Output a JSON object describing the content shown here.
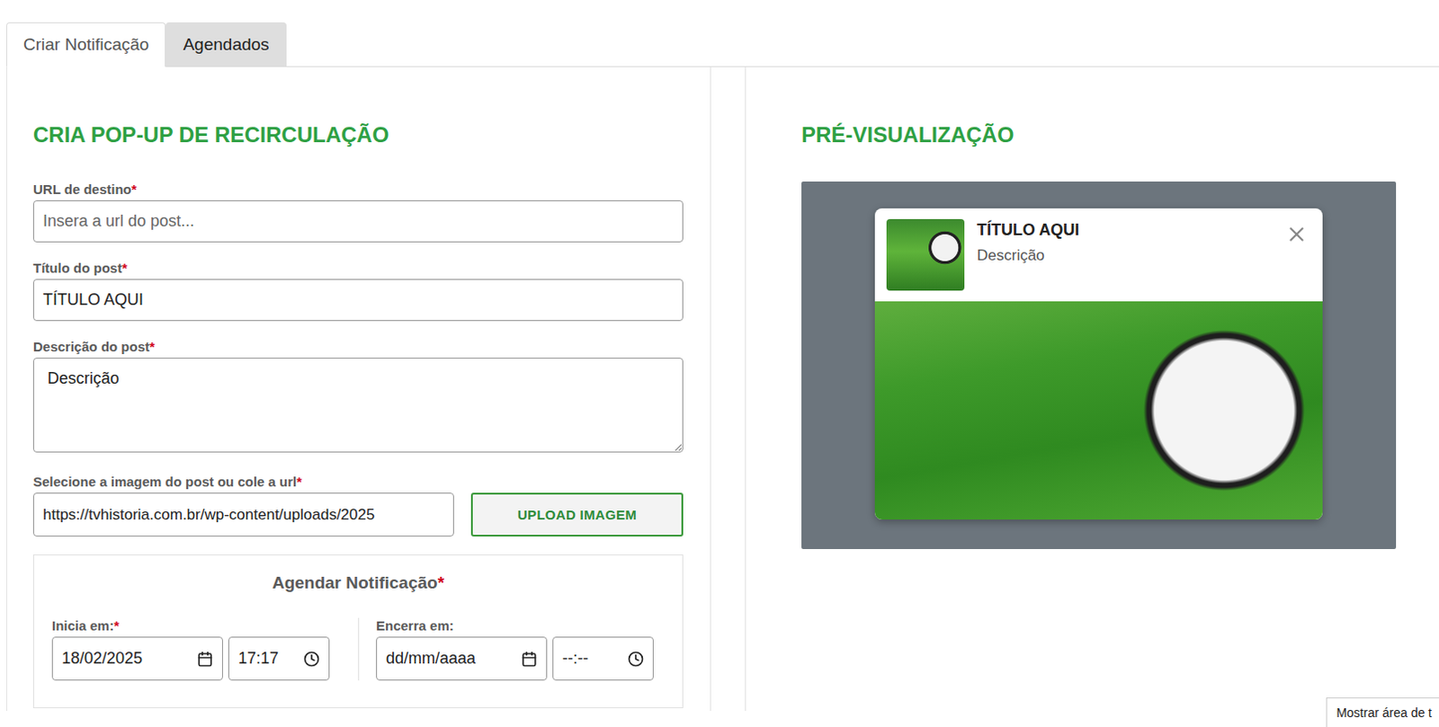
{
  "tabs": [
    {
      "label": "Criar Notificação",
      "selected": true
    },
    {
      "label": "Agendados",
      "selected": false
    }
  ],
  "form": {
    "heading": "CRIA POP-UP DE RECIRCULAÇÃO",
    "required_mark": "*",
    "fields": [
      {
        "label": "URL de destino",
        "required": true,
        "kind": "input",
        "value": "",
        "placeholder": "Insera a url do post..."
      },
      {
        "label": "Título do post",
        "required": true,
        "kind": "input",
        "value": "TÍTULO AQUI",
        "placeholder": ""
      },
      {
        "label": "Descrição do post",
        "required": true,
        "kind": "textarea",
        "value": "Descrição",
        "placeholder": ""
      }
    ],
    "image": {
      "label": "Selecione a imagem do post ou cole a url",
      "required": true,
      "value": "https://tvhistoria.com.br/wp-content/uploads/2025",
      "button": "UPLOAD IMAGEM"
    },
    "schedule": {
      "title": "Agendar Notificação",
      "required": true,
      "start": {
        "label": "Inicia em:",
        "required": true,
        "date": "18/02/2025",
        "time": "17:17"
      },
      "end": {
        "label": "Encerra em:",
        "required": false,
        "date": "dd/mm/aaaa",
        "time": "--:--"
      }
    }
  },
  "preview": {
    "heading": "PRÉ-VISUALIZAÇÃO",
    "card": {
      "title": "TÍTULO AQUI",
      "description": "Descrição"
    }
  },
  "tooltip": "Mostrar área de t"
}
